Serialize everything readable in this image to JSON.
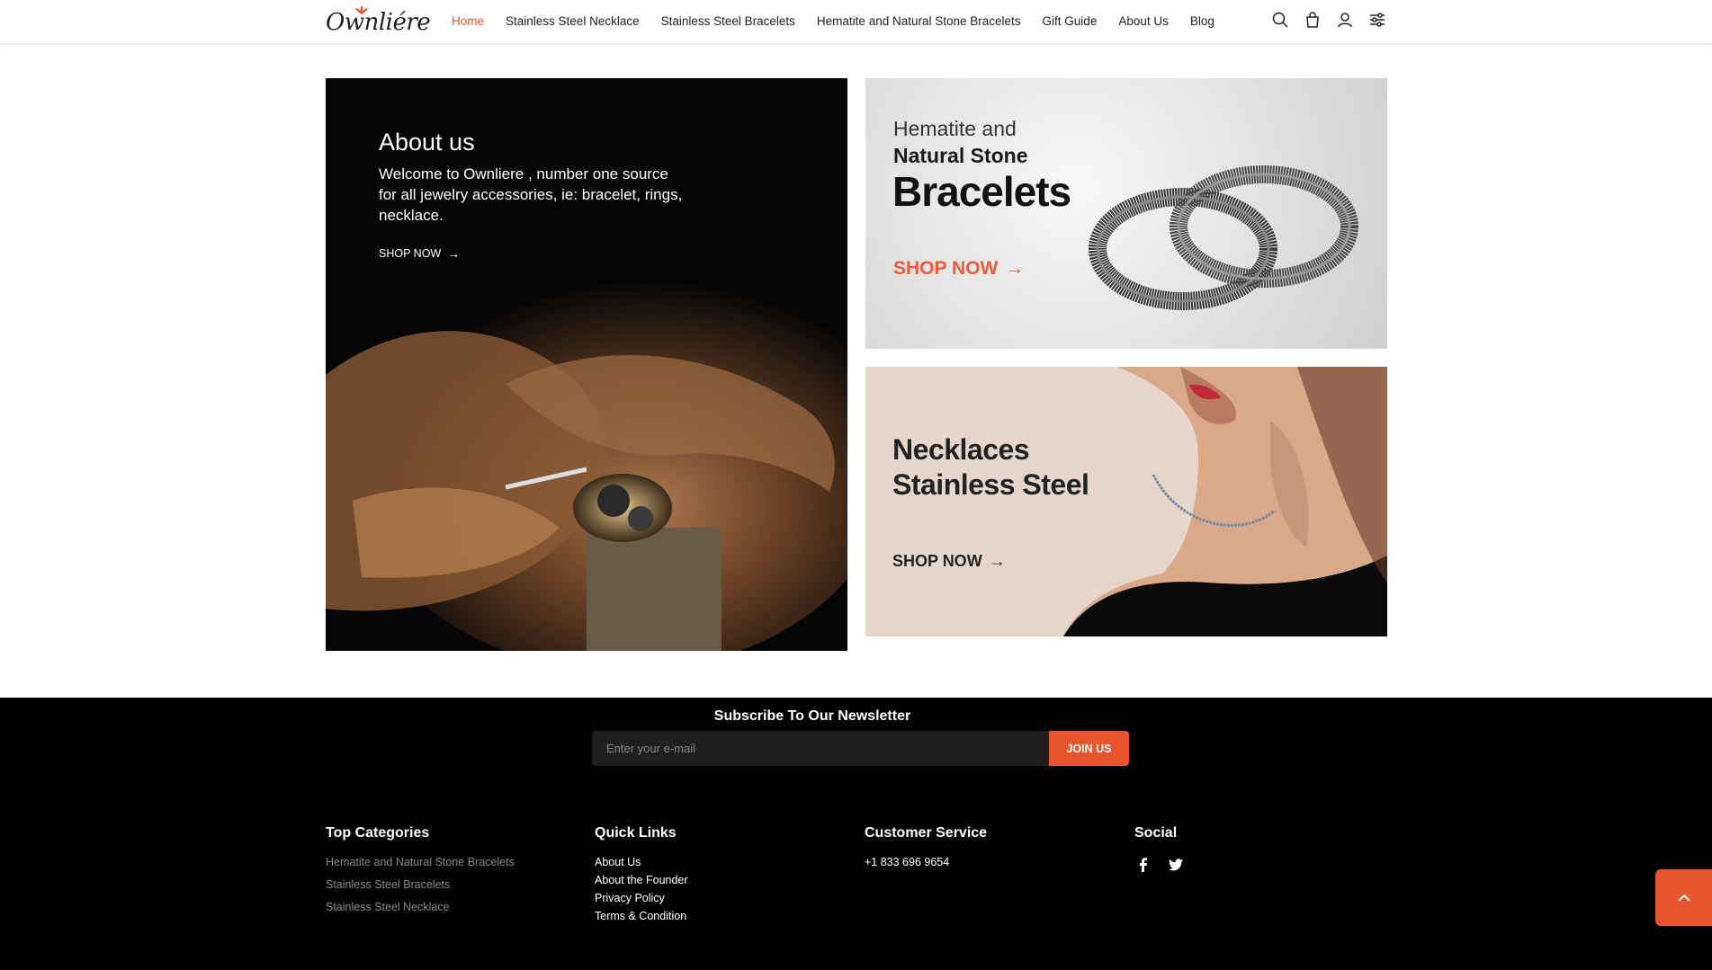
{
  "header": {
    "logo_text": "Ownliére",
    "nav": [
      {
        "label": "Home",
        "active": true
      },
      {
        "label": "Stainless Steel Necklace",
        "active": false
      },
      {
        "label": "Stainless Steel Bracelets",
        "active": false
      },
      {
        "label": "Hematite and Natural Stone Bracelets",
        "active": false
      },
      {
        "label": "Gift Guide",
        "active": false
      },
      {
        "label": "About Us",
        "active": false
      },
      {
        "label": "Blog",
        "active": false
      }
    ],
    "icons": [
      "search-icon",
      "cart-icon",
      "user-icon",
      "settings-icon"
    ],
    "accent_color": "#e8542e"
  },
  "about": {
    "title": "About us",
    "description": "Welcome to Ownliere , number one source for all jewelry accessories, ie: bracelet, rings, necklace.",
    "cta": "SHOP NOW",
    "cta_icon": "arrow-right-icon"
  },
  "banner_bracelets": {
    "line1": "Hematite and",
    "line2": "Natural Stone",
    "line3": "Bracelets",
    "cta": "SHOP NOW",
    "cta_color": "#f05a3c"
  },
  "banner_necklaces": {
    "line1": "Necklaces",
    "line2": "Stainless Steel",
    "cta": "SHOP NOW"
  },
  "newsletter": {
    "title": "Subscribe To Our Newsletter",
    "placeholder": "Enter your e-mail",
    "button": "JOIN US"
  },
  "footer": {
    "top_categories": {
      "title": "Top Categories",
      "links": [
        "Hematite and Natural Stone Bracelets",
        "Stainless Steel Bracelets",
        "Stainless Steel Necklace"
      ]
    },
    "quick_links": {
      "title": "Quick Links",
      "links": [
        "About Us",
        "About the Founder",
        "Privacy Policy",
        "Terms & Condition"
      ]
    },
    "customer_service": {
      "title": "Customer Service",
      "phone": "+1 833 696 9654"
    },
    "social": {
      "title": "Social",
      "icons": [
        "facebook-icon",
        "twitter-icon"
      ]
    }
  },
  "back_to_top_icon": "chevron-up-icon"
}
